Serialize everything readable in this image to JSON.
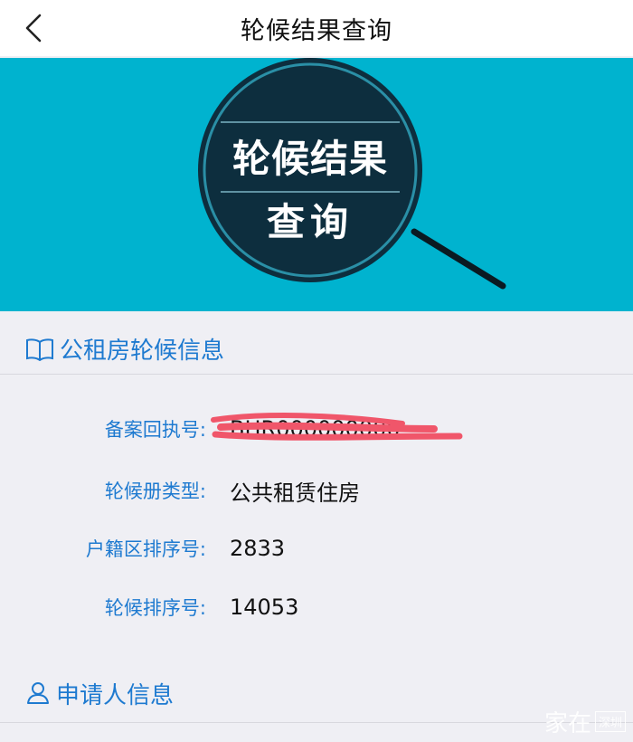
{
  "nav": {
    "title": "轮候结果查询"
  },
  "banner": {
    "line1": "轮候结果",
    "line2": "查询",
    "colors": {
      "background": "#00b3cf",
      "lens": "#0d2e3e"
    }
  },
  "section_housing": {
    "title": "公租房轮候信息",
    "icon": "book-icon"
  },
  "info_rows": [
    {
      "label": "备案回执号:",
      "value": "BHR000000000",
      "redacted": true
    },
    {
      "label": "轮候册类型:",
      "value": "公共租赁住房"
    },
    {
      "label": "户籍区排序号:",
      "value": "2833"
    },
    {
      "label": "轮候排序号:",
      "value": "14053"
    }
  ],
  "section_applicant": {
    "title": "申请人信息",
    "icon": "person-icon"
  },
  "watermark": {
    "main": "家在",
    "sub": "深圳"
  },
  "colors": {
    "accent": "#1e7ad0",
    "redaction": "#f0566a"
  }
}
